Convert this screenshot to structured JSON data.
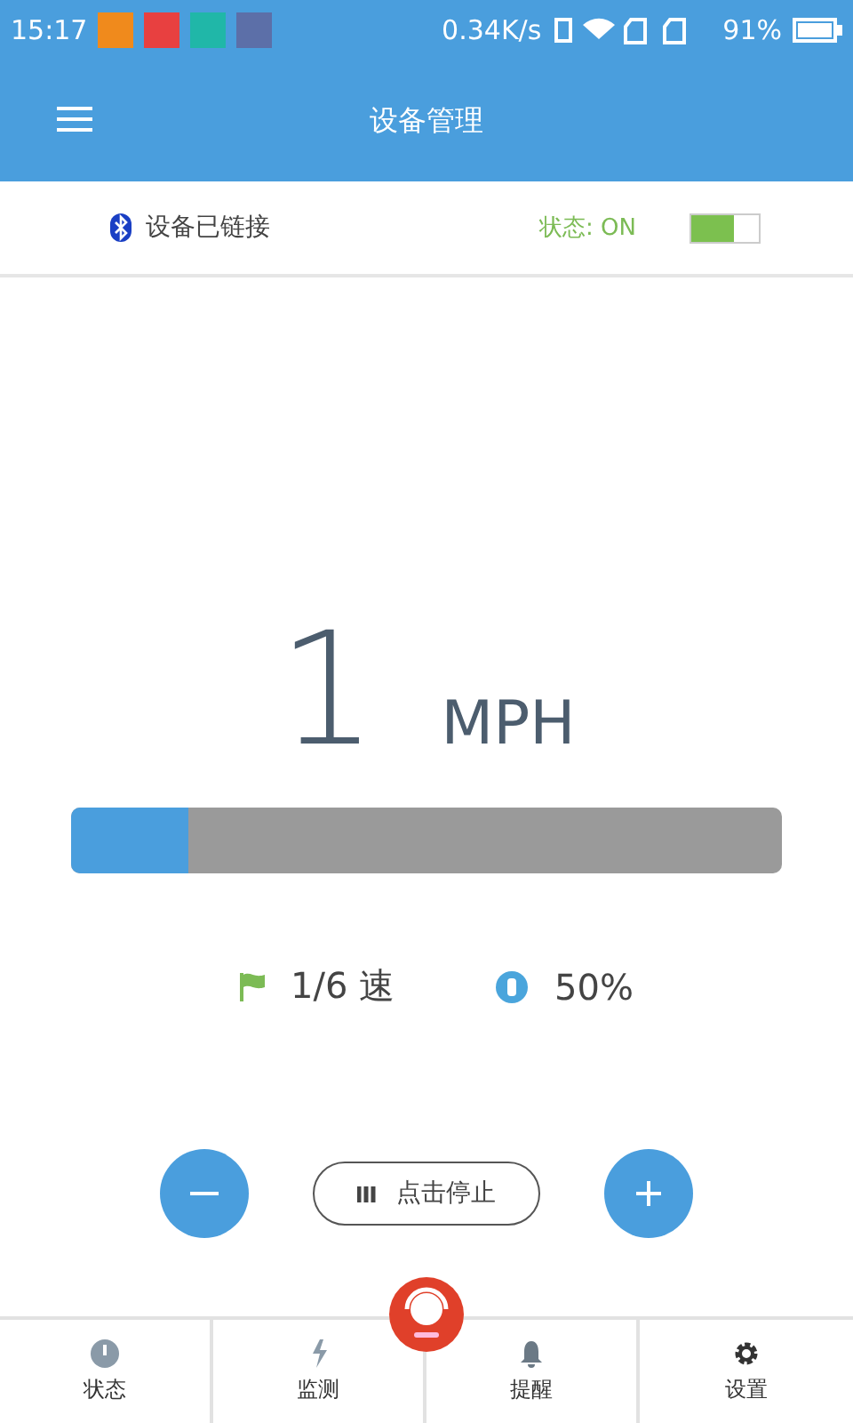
{
  "status_bar": {
    "time": "15:17",
    "speed": "0.34K/s",
    "battery": "91%"
  },
  "app_bar": {
    "title": "设备管理"
  },
  "connection": {
    "label": "设备已链接",
    "status": "状态: ON",
    "on": true
  },
  "speed": {
    "value": "1",
    "unit": "MPH",
    "level": 0.165
  },
  "stats": [
    {
      "kind": "gear",
      "text": "1/6 速"
    },
    {
      "kind": "incline",
      "text": "50%"
    }
  ],
  "controls": {
    "stop": "点击停止"
  },
  "tabs": [
    {
      "label": "状态",
      "kind": "gauge"
    },
    {
      "label": "监测",
      "kind": "bolt"
    },
    {
      "label": "提醒",
      "kind": "bell"
    },
    {
      "label": "设置",
      "kind": "gear"
    }
  ]
}
